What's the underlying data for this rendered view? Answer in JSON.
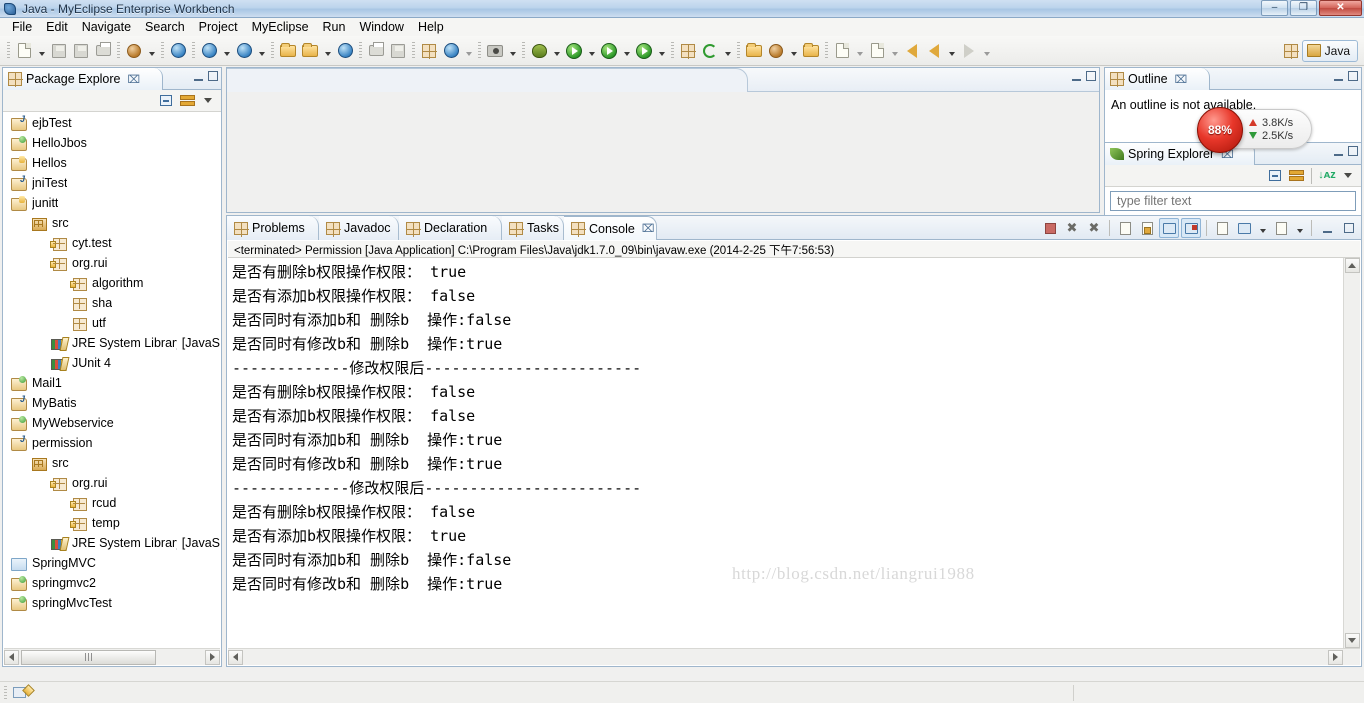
{
  "window": {
    "title": "Java - MyEclipse Enterprise Workbench",
    "minimize_label": "–",
    "restore_label": "❐",
    "close_label": "✕"
  },
  "menu": {
    "items": [
      {
        "label": "File"
      },
      {
        "label": "Edit"
      },
      {
        "label": "Navigate"
      },
      {
        "label": "Search"
      },
      {
        "label": "Project"
      },
      {
        "label": "MyEclipse"
      },
      {
        "label": "Run"
      },
      {
        "label": "Window"
      },
      {
        "label": "Help"
      }
    ]
  },
  "toolbar": {
    "perspective_label": "Java"
  },
  "package_explorer": {
    "tab_label": "Package Explore",
    "close_label": "⌧",
    "tree": [
      {
        "label": "ejbTest",
        "indent": 0,
        "icon": "project-j"
      },
      {
        "label": "HelloJbos",
        "indent": 0,
        "icon": "project-green"
      },
      {
        "label": "Hellos",
        "indent": 0,
        "icon": "project-warn"
      },
      {
        "label": "jniTest",
        "indent": 0,
        "icon": "project-j"
      },
      {
        "label": "junitt",
        "indent": 0,
        "icon": "project-warn"
      },
      {
        "label": "src",
        "indent": 1,
        "icon": "source-folder"
      },
      {
        "label": "cyt.test",
        "indent": 2,
        "icon": "package-warn"
      },
      {
        "label": "org.rui",
        "indent": 2,
        "icon": "package-warn"
      },
      {
        "label": "algorithm",
        "indent": 3,
        "icon": "package-warn"
      },
      {
        "label": "sha",
        "indent": 3,
        "icon": "package"
      },
      {
        "label": "utf",
        "indent": 3,
        "icon": "package"
      },
      {
        "label": "JRE System Library ",
        "dim": "[JavaS",
        "indent": 2,
        "icon": "library"
      },
      {
        "label": "JUnit 4",
        "indent": 2,
        "icon": "library"
      },
      {
        "label": "Mail1",
        "indent": 0,
        "icon": "project-green"
      },
      {
        "label": "MyBatis",
        "indent": 0,
        "icon": "project-j"
      },
      {
        "label": "MyWebservice",
        "indent": 0,
        "icon": "project-green"
      },
      {
        "label": "permission",
        "indent": 0,
        "icon": "project-j"
      },
      {
        "label": "src",
        "indent": 1,
        "icon": "source-folder"
      },
      {
        "label": "org.rui",
        "indent": 2,
        "icon": "package-warn"
      },
      {
        "label": "rcud",
        "indent": 3,
        "icon": "package-warn"
      },
      {
        "label": "temp",
        "indent": 3,
        "icon": "package-warn"
      },
      {
        "label": "JRE System Library ",
        "dim": "[JavaS",
        "indent": 2,
        "icon": "library"
      },
      {
        "label": "SpringMVC",
        "indent": 0,
        "icon": "plain-folder"
      },
      {
        "label": "springmvc2",
        "indent": 0,
        "icon": "project-green"
      },
      {
        "label": "springMvcTest",
        "indent": 0,
        "icon": "project-green"
      }
    ]
  },
  "outline": {
    "tab_label": "Outline",
    "close_label": "⌧",
    "message": "An outline is not available."
  },
  "spring_explorer": {
    "tab_label": "Spring Explorer",
    "close_label": "⌧",
    "filter_placeholder": "type filter text",
    "filter_value": ""
  },
  "net_widget": {
    "percent": "88%",
    "upload": "3.8K/s",
    "download": "2.5K/s"
  },
  "console": {
    "tabs": [
      {
        "label": "Problems",
        "icon": "problems-icon",
        "active": false
      },
      {
        "label": "Javadoc",
        "icon": "javadoc-icon",
        "active": false
      },
      {
        "label": "Declaration",
        "icon": "declaration-icon",
        "active": false
      },
      {
        "label": "Tasks",
        "icon": "tasks-icon",
        "active": false
      },
      {
        "label": "Console",
        "icon": "console-icon",
        "active": true
      }
    ],
    "close_label": "⌧",
    "status_line": "<terminated> Permission [Java Application] C:\\Program Files\\Java\\jdk1.7.0_09\\bin\\javaw.exe (2014-2-25 下午7:56:53)",
    "output_lines": [
      "是否有删除b权限操作权限： true",
      "是否有添加b权限操作权限： false",
      "是否同时有添加b和 删除b  操作:false",
      "是否同时有修改b和 删除b  操作:true",
      "-------------修改权限后------------------------",
      "是否有删除b权限操作权限： false",
      "是否有添加b权限操作权限： false",
      "是否同时有添加b和 删除b  操作:true",
      "是否同时有修改b和 删除b  操作:true",
      "-------------修改权限后------------------------",
      "是否有删除b权限操作权限： false",
      "是否有添加b权限操作权限： true",
      "是否同时有添加b和 删除b  操作:false",
      "是否同时有修改b和 删除b  操作:true"
    ]
  },
  "watermark": {
    "text": "http://blog.csdn.net/liangrui1988"
  },
  "colors": {
    "title_accent": "#a8c6e4",
    "panel_border": "#9fb6cc",
    "close_red": "#c04a40",
    "net_ball": "#e8372a",
    "upload": "#d43a2a",
    "download": "#2f9a3a"
  }
}
